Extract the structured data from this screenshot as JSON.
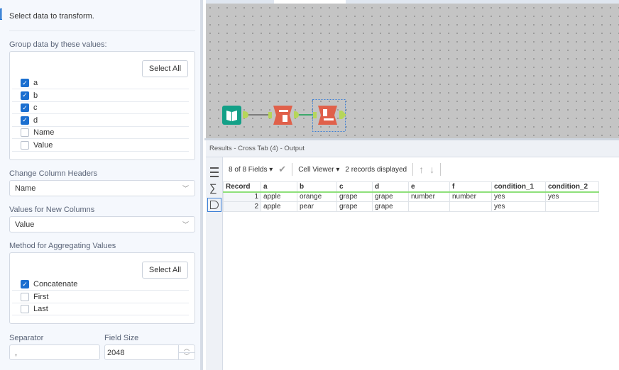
{
  "config": {
    "intro": "Select data to transform.",
    "group_label": "Group data by these values:",
    "select_all": "Select All",
    "group_fields": [
      {
        "label": "a",
        "checked": true
      },
      {
        "label": "b",
        "checked": true
      },
      {
        "label": "c",
        "checked": true
      },
      {
        "label": "d",
        "checked": true
      },
      {
        "label": "Name",
        "checked": false
      },
      {
        "label": "Value",
        "checked": false
      }
    ],
    "headers_label": "Change Column Headers",
    "headers_value": "Name",
    "values_label": "Values for New Columns",
    "values_value": "Value",
    "method_label": "Method for Aggregating Values",
    "methods": [
      {
        "label": "Concatenate",
        "checked": true
      },
      {
        "label": "First",
        "checked": false
      },
      {
        "label": "Last",
        "checked": false
      }
    ],
    "separator_label": "Separator",
    "separator_value": ",",
    "fieldsize_label": "Field Size",
    "fieldsize_value": "2048"
  },
  "results": {
    "title": "Results - Cross Tab (4) - Output",
    "fields": "8 of 8 Fields",
    "viewer": "Cell Viewer",
    "records": "2 records displayed",
    "columns": [
      "Record",
      "a",
      "b",
      "c",
      "d",
      "e",
      "f",
      "condition_1",
      "condition_2"
    ],
    "rows": [
      [
        "1",
        "apple",
        "orange",
        "grape",
        "grape",
        "number",
        "number",
        "yes",
        "yes"
      ],
      [
        "2",
        "apple",
        "pear",
        "grape",
        "grape",
        "",
        "",
        "yes",
        ""
      ]
    ]
  },
  "colors": {
    "accent": "#1b6fd0",
    "tool_teal": "#13a087",
    "tool_red": "#e0604a",
    "connector": "#b6d65a"
  }
}
